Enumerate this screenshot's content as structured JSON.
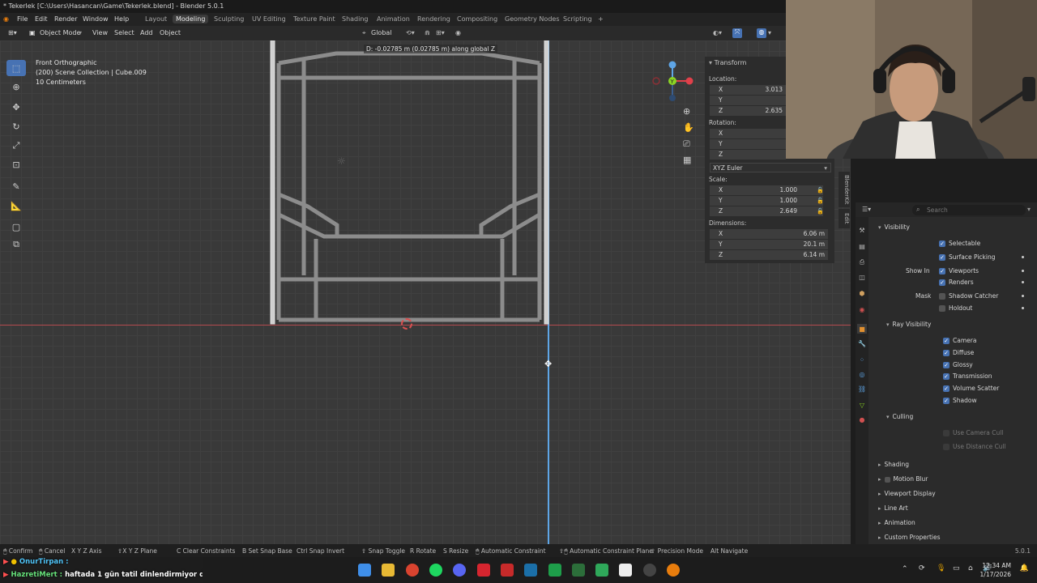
{
  "window": {
    "title": "* Tekerlek [C:\\Users\\Hasancan\\Game\\Tekerlek.blend] - Blender 5.0.1"
  },
  "menu": [
    "File",
    "Edit",
    "Render",
    "Window",
    "Help"
  ],
  "workspaces": [
    {
      "label": "Layout"
    },
    {
      "label": "Modeling"
    },
    {
      "label": "Sculpting"
    },
    {
      "label": "UV Editing"
    },
    {
      "label": "Texture Paint"
    },
    {
      "label": "Shading"
    },
    {
      "label": "Animation"
    },
    {
      "label": "Rendering"
    },
    {
      "label": "Compositing"
    },
    {
      "label": "Geometry Nodes"
    },
    {
      "label": "Scripting"
    },
    {
      "label": "+"
    }
  ],
  "active_workspace": "Modeling",
  "header": {
    "mode": "Object Mode",
    "view": "View",
    "select": "Select",
    "add": "Add",
    "object": "Object",
    "orientation": "Global"
  },
  "viewport": {
    "view_name": "Front Orthographic",
    "collection_info": "(200) Scene Collection | Cube.009",
    "scale_info": "10 Centimeters",
    "transform_hint": "D: -0.02785 m (0.02785 m) along global Z"
  },
  "npanel": {
    "title": "Transform",
    "location_label": "Location:",
    "location": [
      {
        "axis": "X",
        "value": "3.013"
      },
      {
        "axis": "Y",
        "value": ""
      },
      {
        "axis": "Z",
        "value": "2.635"
      }
    ],
    "rotation_label": "Rotation:",
    "rotation": [
      {
        "axis": "X",
        "value": ""
      },
      {
        "axis": "Y",
        "value": ""
      },
      {
        "axis": "Z",
        "value": ""
      }
    ],
    "rotation_mode": "XYZ Euler",
    "scale_label": "Scale:",
    "scale": [
      {
        "axis": "X",
        "value": "1.000"
      },
      {
        "axis": "Y",
        "value": "1.000"
      },
      {
        "axis": "Z",
        "value": "2.649"
      }
    ],
    "dimensions_label": "Dimensions:",
    "dimensions": [
      {
        "axis": "X",
        "value": "6.06 m"
      },
      {
        "axis": "Y",
        "value": "20.1 m"
      },
      {
        "axis": "Z",
        "value": "6.14 m"
      }
    ],
    "side_tabs": [
      "BlenderKit",
      "Edit"
    ]
  },
  "properties": {
    "search_placeholder": "Search",
    "visibility_title": "Visibility",
    "selectable": "Selectable",
    "surface_picking": "Surface Picking",
    "show_in": "Show In",
    "viewports": "Viewports",
    "renders": "Renders",
    "mask": "Mask",
    "shadow_catcher": "Shadow Catcher",
    "holdout": "Holdout",
    "ray_visibility_title": "Ray Visibility",
    "ray_items": [
      "Camera",
      "Diffuse",
      "Glossy",
      "Transmission",
      "Volume Scatter",
      "Shadow"
    ],
    "culling_title": "Culling",
    "use_camera_cull": "Use Camera Cull",
    "use_distance_cull": "Use Distance Cull",
    "collapsed_sections": [
      "Shading",
      "Motion Blur",
      "Viewport Display",
      "Line Art",
      "Animation",
      "Custom Properties"
    ]
  },
  "status": {
    "items": [
      {
        "key": "",
        "label": "Confirm"
      },
      {
        "key": "",
        "label": "Cancel"
      },
      {
        "key": "X Y Z",
        "label": "Axis"
      },
      {
        "key": "X Y Z",
        "label": "Plane"
      },
      {
        "key": "C",
        "label": "Clear Constraints"
      },
      {
        "key": "B",
        "label": "Set Snap Base"
      },
      {
        "key": "Ctrl",
        "label": "Snap Invert"
      },
      {
        "key": "",
        "label": "Snap Toggle"
      },
      {
        "key": "R",
        "label": "Rotate"
      },
      {
        "key": "S",
        "label": "Resize"
      },
      {
        "key": "",
        "label": "Automatic Constraint"
      },
      {
        "key": "",
        "label": "Automatic Constraint Plane"
      },
      {
        "key": "",
        "label": "Precision Mode"
      },
      {
        "key": "Alt",
        "label": "Navigate"
      }
    ],
    "version": "5.0.1"
  },
  "chat": [
    {
      "user": "OnurTirpan :",
      "message": ""
    },
    {
      "user": "HazretiMert :",
      "message": "haftada 1 gün tatil dinlendirmiyor da ya"
    }
  ],
  "taskbar": {
    "time": "12:34 AM",
    "date": "1/17/2026"
  },
  "colors": {
    "accent": "#4772b3",
    "x_axis": "#e0404a",
    "z_axis_line": "#5ea5e6",
    "y_axis": "#8bd424"
  }
}
